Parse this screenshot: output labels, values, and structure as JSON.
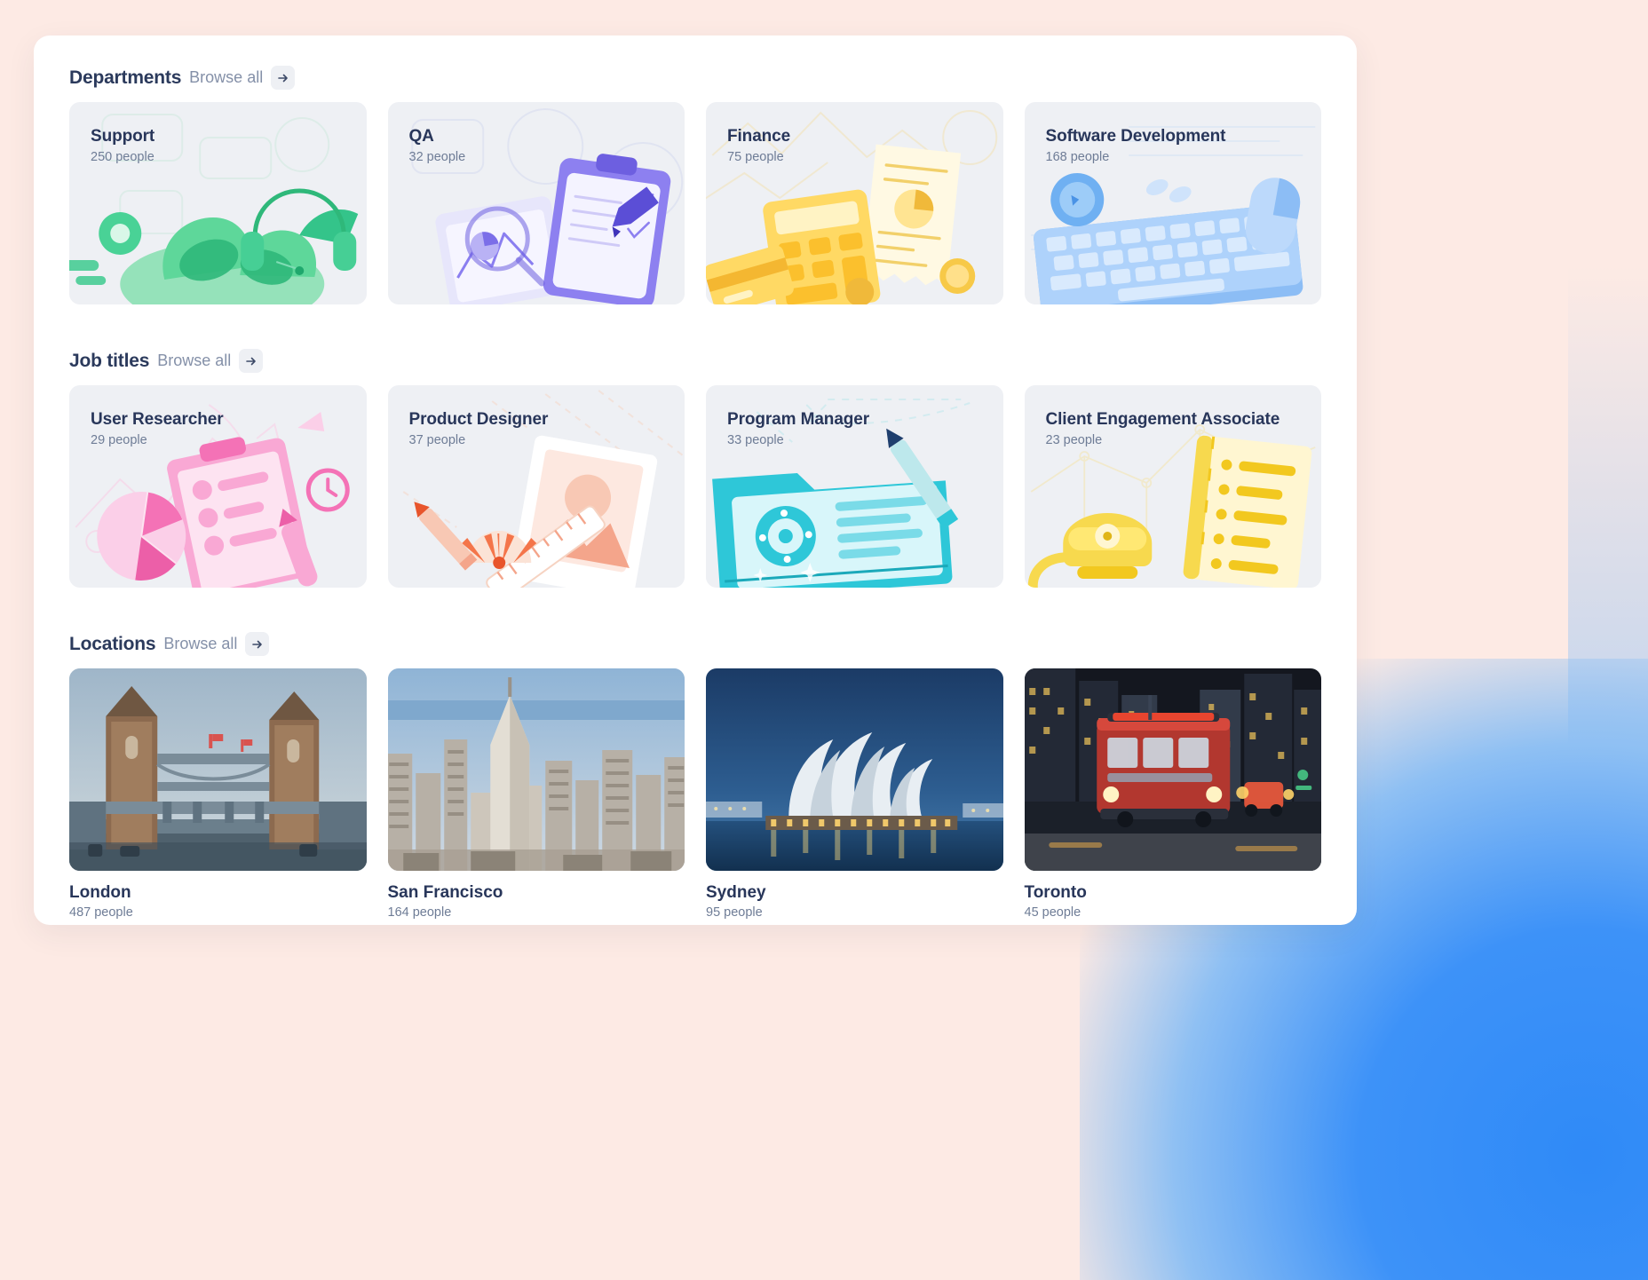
{
  "theme": {
    "page_bg": "#fdeae4",
    "card_bg": "#ffffff",
    "tile_bg": "#eef0f4",
    "title_color": "#28365a",
    "muted_color": "#6e7c96",
    "accent_blue": "#3d92f8"
  },
  "sections": [
    {
      "id": "departments",
      "title": "Departments",
      "browse_label": "Browse all",
      "arrow_icon": "arrow-right-icon",
      "items": [
        {
          "name": "Support",
          "count": "250 people",
          "art": "support"
        },
        {
          "name": "QA",
          "count": "32 people",
          "art": "qa"
        },
        {
          "name": "Finance",
          "count": "75 people",
          "art": "finance"
        },
        {
          "name": "Software Development",
          "count": "168 people",
          "art": "software"
        }
      ]
    },
    {
      "id": "job-titles",
      "title": "Job titles",
      "browse_label": "Browse all",
      "arrow_icon": "arrow-right-icon",
      "items": [
        {
          "name": "User Researcher",
          "count": "29 people",
          "art": "researcher"
        },
        {
          "name": "Product Designer",
          "count": "37 people",
          "art": "designer"
        },
        {
          "name": "Program Manager",
          "count": "33 people",
          "art": "manager"
        },
        {
          "name": "Client Engagement Associate",
          "count": "23 people",
          "art": "client"
        }
      ]
    },
    {
      "id": "locations",
      "title": "Locations",
      "browse_label": "Browse all",
      "arrow_icon": "arrow-right-icon",
      "items": [
        {
          "name": "London",
          "count": "487 people",
          "art": "london"
        },
        {
          "name": "San Francisco",
          "count": "164 people",
          "art": "sanfrancisco"
        },
        {
          "name": "Sydney",
          "count": "95 people",
          "art": "sydney"
        },
        {
          "name": "Toronto",
          "count": "45 people",
          "art": "toronto"
        }
      ]
    }
  ]
}
